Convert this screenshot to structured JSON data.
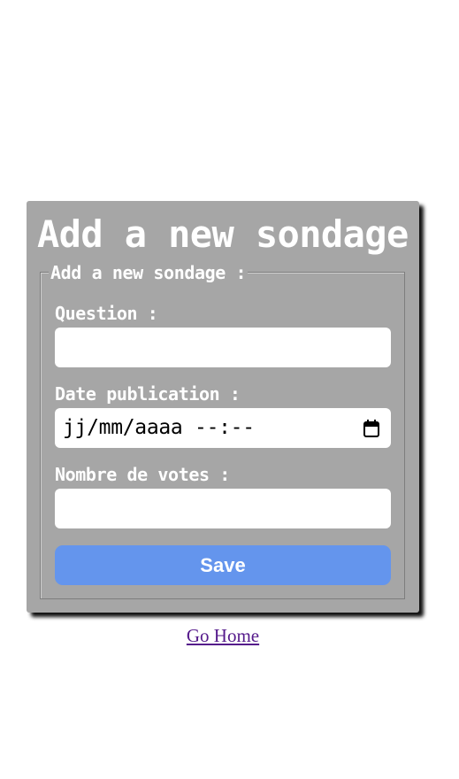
{
  "form": {
    "title": "Add a new sondage",
    "legend": "Add a new sondage :",
    "question_label": "Question :",
    "question_value": "",
    "date_label": "Date publication :",
    "date_placeholder": "jj/mm/aaaa --:--",
    "votes_label": "Nombre de votes :",
    "votes_value": "",
    "save_label": "Save",
    "calendar_icon": "calendar-icon"
  },
  "footer": {
    "home_link": "Go Home"
  },
  "colors": {
    "card_background": "#a6a6a6",
    "button_accent": "#6495ed",
    "visited_link": "#551a8b"
  }
}
